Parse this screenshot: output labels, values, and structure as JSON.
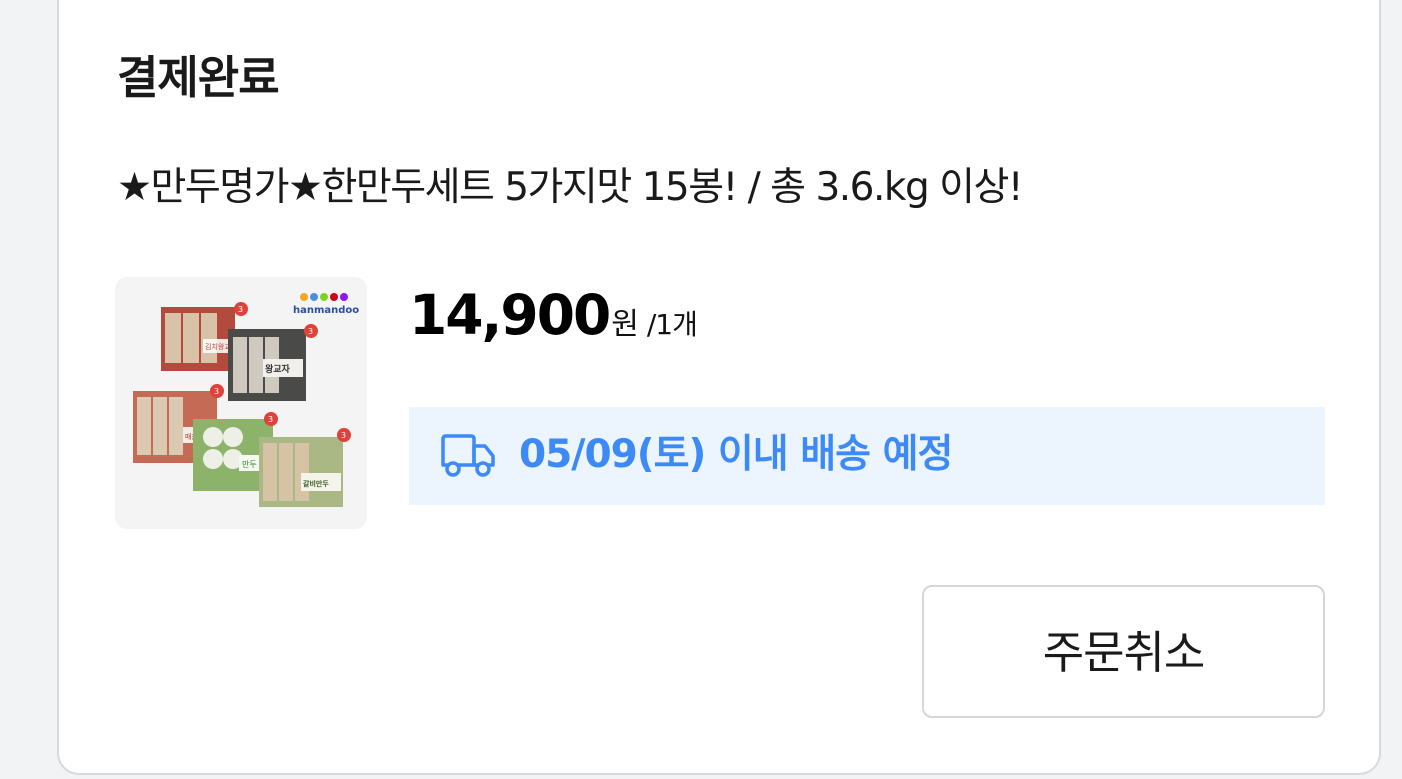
{
  "order": {
    "status": "결제완료",
    "product_name": "★만두명가★한만두세트 5가지맛 15봉! / 총 3.6.kg 이상!",
    "price": "14,900",
    "currency": "원",
    "quantity": "/1개",
    "delivery": {
      "icon": "truck-icon",
      "text": "05/09(토) 이내 배송 예정",
      "color": "#3d8af7",
      "background": "#ecf5fe"
    },
    "thumbnail": {
      "brand": "hanmandoo",
      "labels": [
        "김치왕교자",
        "왕교자",
        "매운만",
        "만두",
        "갈비만두"
      ],
      "badge": "3"
    },
    "cancel_label": "주문취소"
  }
}
